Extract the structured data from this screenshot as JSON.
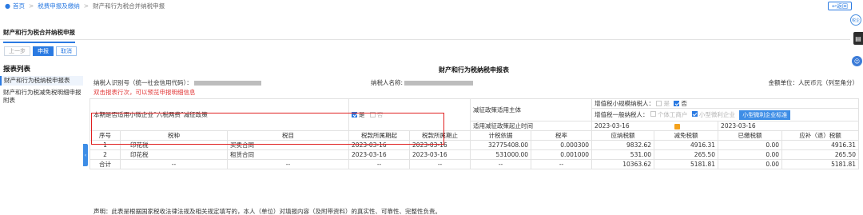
{
  "breadcrumb": {
    "home": "首页",
    "link": "税费申报及缴纳",
    "current": "财产和行为税合并纳税申报"
  },
  "back_label": "返回",
  "float_circle_label": "税企",
  "tab_title": "财产和行为税合并纳税申报",
  "sidebar": {
    "buttons": {
      "prev": "上一步",
      "submit": "申报",
      "cancel": "取消"
    },
    "list_title": "报表列表",
    "items": [
      {
        "label": "财产和行为税纳税申报表"
      },
      {
        "label": "财产和行为税减免税明细申报附表"
      }
    ]
  },
  "form": {
    "title": "财产和行为税纳税申报表",
    "taxpayer_id_label": "纳税人识别号（统一社会信用代码）：",
    "taxpayer_name_label": "纳税人名称:",
    "unit_label": "金额单位：人民币元（列至角分）",
    "hint": "双击报表行次，可以预览申报明细信息"
  },
  "policy": {
    "question": "本期是否适用小微企业“六税两费”减征政策",
    "yes": "是",
    "no": "否",
    "subject_label": "减征政策适用主体",
    "small_scale_label": "增值税小规模纳税人：",
    "small_scale_yes": "是",
    "small_scale_no": "否",
    "general_label": "增值税一般纳税人：",
    "general_opt1": "个体工商户",
    "general_opt2": "小型微利企业",
    "general_button": "小型微利企业标准",
    "period_label": "适用减征政策起止时间",
    "period_start": "2023-03-16",
    "period_end": "2023-03-16"
  },
  "table": {
    "headers": [
      "序号",
      "税种",
      "税目",
      "税款所属期起",
      "税款所属期止",
      "计税依据",
      "税率",
      "应纳税额",
      "减免税额",
      "已缴税额",
      "应补（退）税额"
    ],
    "rows": [
      {
        "no": "1",
        "tax": "印花税",
        "item": "买卖合同",
        "start": "2023-03-16",
        "end": "2023-03-16",
        "basis": "32775408.00",
        "rate": "0.000300",
        "payable": "9832.62",
        "relief": "4916.31",
        "paid": "0.00",
        "due": "4916.31"
      },
      {
        "no": "2",
        "tax": "印花税",
        "item": "租赁合同",
        "start": "2023-03-16",
        "end": "2023-03-16",
        "basis": "531000.00",
        "rate": "0.001000",
        "payable": "531.00",
        "relief": "265.50",
        "paid": "0.00",
        "due": "265.50"
      }
    ],
    "total": {
      "label": "合计",
      "dash": "--",
      "payable": "10363.62",
      "relief": "5181.81",
      "paid": "0.00",
      "due": "5181.81"
    }
  },
  "declaration": "声明：此表是根据国家税收法律法规及相关规定填写的，本人（单位）对填报内容（及附带资料）的真实性、可靠性、完整性负责。"
}
